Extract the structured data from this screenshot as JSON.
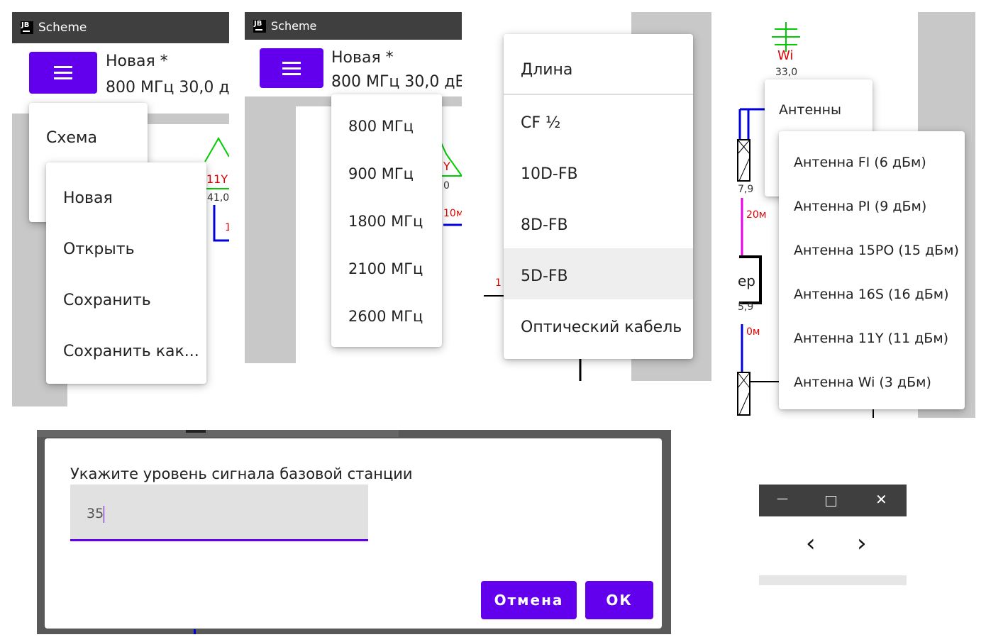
{
  "app": {
    "logo": "JB",
    "title": "Scheme",
    "header": {
      "doc_title": "Новая *",
      "params_1": "800 МГц  30,0 д",
      "params_2": "800 МГц  30,0 дБ"
    }
  },
  "menu_main": {
    "item_scheme": "Схема"
  },
  "menu_file": {
    "items": [
      "Новая",
      "Открыть",
      "Сохранить",
      "Сохранить как..."
    ]
  },
  "menu_freq": {
    "items": [
      "800 МГц",
      "900 МГц",
      "1800 МГц",
      "2100 МГц",
      "2600 МГц"
    ]
  },
  "menu_cable": {
    "header": "Длина",
    "items": [
      "CF ½",
      "10D-FB",
      "8D-FB",
      "5D-FB",
      "Оптический кабель"
    ],
    "highlighted": "5D-FB"
  },
  "menu_antenna": {
    "parent": "Антенны",
    "items": [
      "Антенна FI (6 дБм)",
      "Антенна PI (9 дБм)",
      "Антенна 15PO (15 дБм)",
      "Антенна 16S (16 дБм)",
      "Антенна 11Y (11 дБм)",
      "Антенна Wi (3 дБм)"
    ]
  },
  "scheme": {
    "p1_label": "11Y",
    "p1_value": "41,0",
    "p1_cable": "1",
    "p2_label": "Y",
    "p2_value": "0",
    "p2_cable": "10м",
    "p2_left": "1",
    "p4_antenna": "Wi",
    "p4_value": "33,0",
    "p4_v1": "7,9",
    "p4_cable1": "20м",
    "p4_box": "ер",
    "p4_v2": "5,9",
    "p4_cable2": "0м"
  },
  "dialog": {
    "prompt": "Укажите уровень сигнала базовой станции",
    "value": "35",
    "cancel": "Отмена",
    "ok": "ОК"
  },
  "window_controls": {
    "minimize": "—",
    "close": "✕",
    "back": "‹",
    "forward": "›"
  },
  "colors": {
    "accent": "#6200ee",
    "titlebar": "#3f3f3f",
    "antenna_green": "#00cc00",
    "cable_blue": "#0000dd",
    "cable_magenta": "#ee00ee",
    "label_red": "#e00000"
  }
}
